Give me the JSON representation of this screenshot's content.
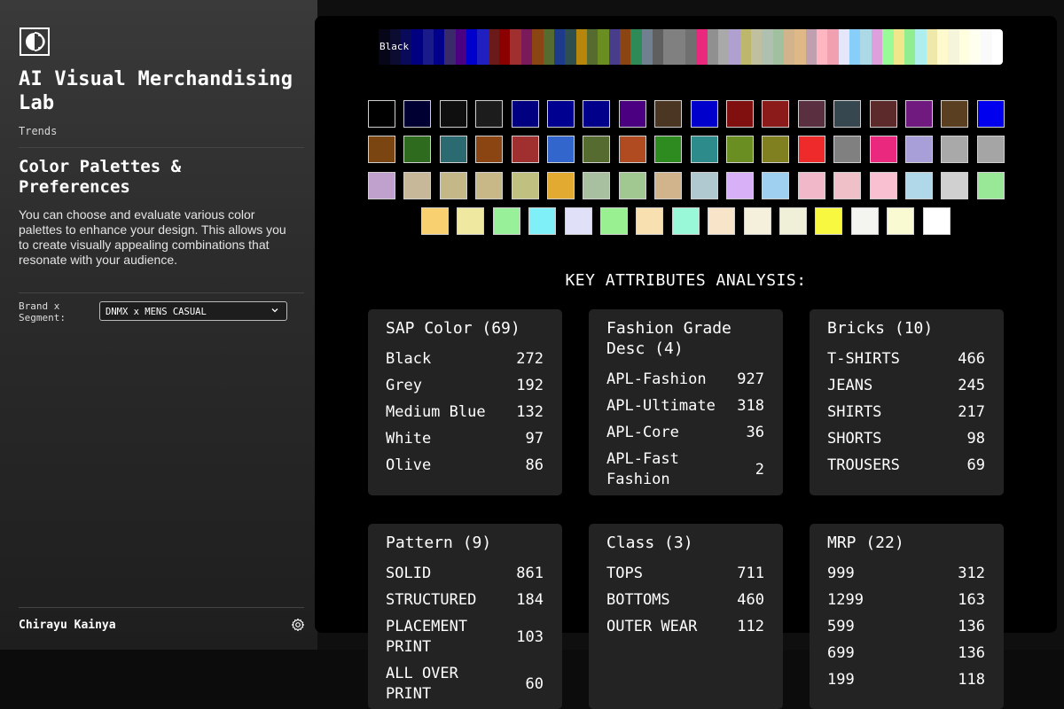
{
  "sidebar": {
    "app_title": "AI Visual Merchandising Lab",
    "breadcrumb": "Trends",
    "section_title": "Color Palettes & Preferences",
    "section_description": "You can choose and evaluate various color palettes to enhance your design. This allows you to create visually appealing combinations that resonate with your audience.",
    "brand_label": "Brand x Segment:",
    "brand_value": "DNMX x MENS CASUAL",
    "user_name": "Chirayu Kainya"
  },
  "main": {
    "gradient_label": "Black",
    "gradient_colors": [
      "#000000",
      "#060618",
      "#0c0c30",
      "#0a0a5a",
      "#000080",
      "#1a1a8a",
      "#00008b",
      "#3a2a6a",
      "#4b0082",
      "#0000cd",
      "#2020c0",
      "#6b1a1a",
      "#8b0000",
      "#a03030",
      "#7a1a5a",
      "#8b4513",
      "#556b2f",
      "#1e3a8a",
      "#2f4f4f",
      "#b8860b",
      "#556b2f",
      "#6b8e23",
      "#483d8b",
      "#8b4513",
      "#2e8b57",
      "#708090",
      "#5f5f5f",
      "#808080",
      "#808080",
      "#707070",
      "#e9287e",
      "#909090",
      "#a9a9a9",
      "#b0a0d0",
      "#bdb76b",
      "#c0c0a0",
      "#b0c0b0",
      "#a0c0a0",
      "#d2b48c",
      "#deb887",
      "#c0a0b0",
      "#ffb6c1",
      "#f0a0b0",
      "#e6e6fa",
      "#87cefa",
      "#add8e6",
      "#dda0dd",
      "#98fb98",
      "#f0e68c",
      "#90ee90",
      "#afeeee",
      "#eee8aa",
      "#fffacd",
      "#f5f5dc",
      "#ffffe0",
      "#fffff0",
      "#fafafa",
      "#ffffff"
    ],
    "swatches": [
      [
        "#000000",
        "#000033",
        "#0f0f0f",
        "#1c1c1c",
        "#000080",
        "#000090",
        "#00008b",
        "#4b0082",
        "#4a3623",
        "#0000cd",
        "#801010",
        "#8b1a1a",
        "#5a3040",
        "#37474f",
        "#5c2a2a",
        "#701a80",
        "#5a4020",
        "#0000ee"
      ],
      [
        "#7a4510",
        "#2e6b1e",
        "#2a6a70",
        "#8b4513",
        "#a03030",
        "#3366cc",
        "#556b2f",
        "#b04a20",
        "#2e8b20",
        "#2e8b8b",
        "#6b8e23",
        "#808020",
        "#ee2a2a",
        "#808080",
        "#e9287e",
        "#a99fd8",
        "#a9a9a9",
        "#a5a5a5"
      ],
      [
        "#c0a0cc",
        "#c8b89a",
        "#c5b888",
        "#c8b888",
        "#c0c080",
        "#e2aa30",
        "#a8c0a0",
        "#a0c890",
        "#d2b48c",
        "#b0c8d0",
        "#d8b0f8",
        "#a0d0f0",
        "#f0b8c8",
        "#f0c0c8",
        "#f8c0d0",
        "#b0d8e8",
        "#d0d0d0",
        "#98e898"
      ],
      [
        "#f8d070",
        "#eee8a0",
        "#98f098",
        "#80f0f8",
        "#e0e0f8",
        "#98f090",
        "#f8e0b0",
        "#98f8d8",
        "#f8e4c8",
        "#f4f0dc",
        "#f0f0d8",
        "#f8f840",
        "#f4f4f0",
        "#fafad2",
        "#ffffff"
      ]
    ],
    "key_attributes_title": "KEY ATTRIBUTES ANALYSIS:",
    "cards": [
      {
        "title": "SAP Color (69)",
        "rows": [
          [
            "Black",
            "272"
          ],
          [
            "Grey",
            "192"
          ],
          [
            "Medium Blue",
            "132"
          ],
          [
            "White",
            "97"
          ],
          [
            "Olive",
            "86"
          ]
        ]
      },
      {
        "title": "Fashion Grade Desc (4)",
        "rows": [
          [
            "APL-Fashion",
            "927"
          ],
          [
            "APL-Ultimate",
            "318"
          ],
          [
            "APL-Core",
            "36"
          ],
          [
            "APL-Fast Fashion",
            "2"
          ]
        ]
      },
      {
        "title": "Bricks (10)",
        "rows": [
          [
            "T-SHIRTS",
            "466"
          ],
          [
            "JEANS",
            "245"
          ],
          [
            "SHIRTS",
            "217"
          ],
          [
            "SHORTS",
            "98"
          ],
          [
            "TROUSERS",
            "69"
          ]
        ]
      },
      {
        "title": "Pattern (9)",
        "rows": [
          [
            "SOLID",
            "861"
          ],
          [
            "STRUCTURED",
            "184"
          ],
          [
            "PLACEMENT PRINT",
            "103"
          ],
          [
            "ALL OVER PRINT",
            "60"
          ]
        ]
      },
      {
        "title": "Class (3)",
        "rows": [
          [
            "TOPS",
            "711"
          ],
          [
            "BOTTOMS",
            "460"
          ],
          [
            "OUTER WEAR",
            "112"
          ]
        ]
      },
      {
        "title": "MRP (22)",
        "rows": [
          [
            "999",
            "312"
          ],
          [
            "1299",
            "163"
          ],
          [
            "599",
            "136"
          ],
          [
            "699",
            "136"
          ],
          [
            "199",
            "118"
          ]
        ]
      }
    ]
  }
}
